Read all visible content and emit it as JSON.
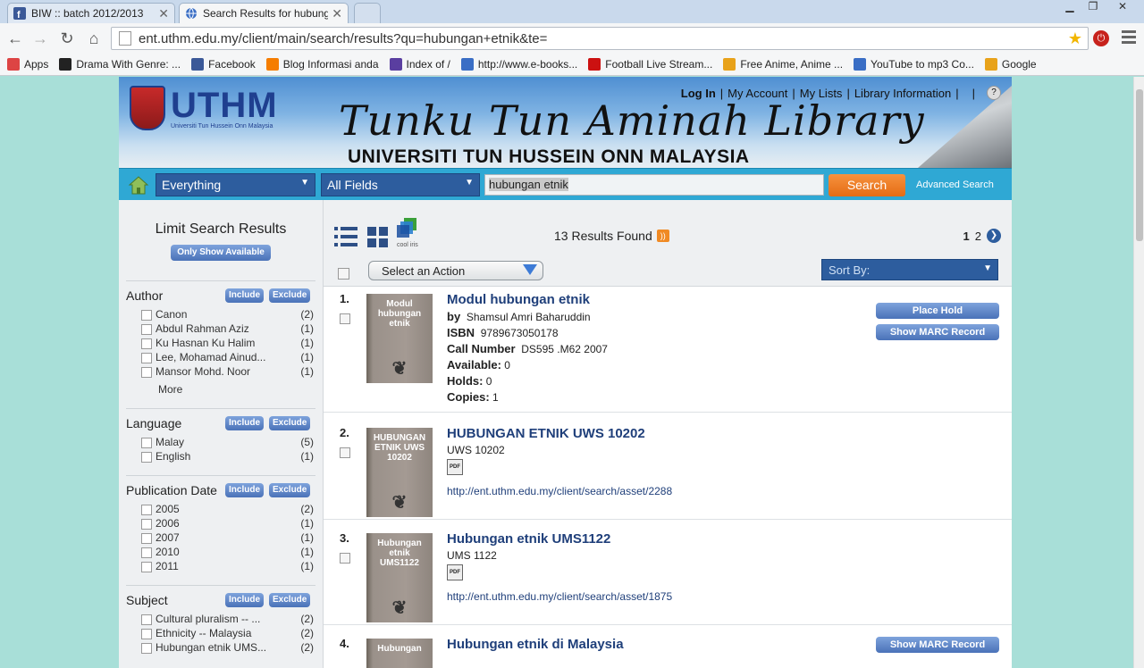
{
  "browser": {
    "tabs": [
      {
        "title": "BIW :: batch 2012/2013",
        "favicon": "facebook-icon"
      },
      {
        "title": "Search Results for hubung",
        "favicon": "globe-icon"
      }
    ],
    "url": "ent.uthm.edu.my/client/main/search/results?qu=hubungan+etnik&te=",
    "bookmarks": [
      {
        "label": "Apps",
        "icon": "apps-grid-icon",
        "color": "#d44"
      },
      {
        "label": "Drama With Genre: ...",
        "icon": "drama-icon",
        "color": "#222"
      },
      {
        "label": "Facebook",
        "icon": "facebook-icon",
        "color": "#3b5998"
      },
      {
        "label": "Blog Informasi anda",
        "icon": "blogger-icon",
        "color": "#f57d00"
      },
      {
        "label": "Index of /",
        "icon": "shield-icon",
        "color": "#5a3ea0"
      },
      {
        "label": "http://www.e-books...",
        "icon": "circle-icon",
        "color": "#3a6ec5"
      },
      {
        "label": "Football Live Stream...",
        "icon": "tv-icon",
        "color": "#c11"
      },
      {
        "label": "Free Anime, Anime ...",
        "icon": "anime-icon",
        "color": "#e8a21a"
      },
      {
        "label": "YouTube to mp3 Co...",
        "icon": "mp3-icon",
        "color": "#3a6ec5"
      },
      {
        "label": "Google",
        "icon": "google-icon",
        "color": "#e8a21a"
      }
    ]
  },
  "site": {
    "logo_text": "UTHM",
    "logo_subtext": "Universiti Tun Hussein Onn Malaysia",
    "library_title": "Tunku Tun Aminah Library",
    "library_subtitle": "UNIVERSITI TUN HUSSEIN ONN MALAYSIA",
    "top_links": [
      "Log In",
      "My Account",
      "My Lists",
      "Library Information"
    ]
  },
  "search": {
    "scope": "Everything",
    "field": "All Fields",
    "query": "hubungan etnik",
    "button": "Search",
    "advanced": "Advanced Search"
  },
  "sidebar": {
    "title": "Limit Search Results",
    "only_available": "Only Show Available",
    "include": "Include",
    "exclude": "Exclude",
    "more": "More",
    "facets": [
      {
        "name": "Author",
        "items": [
          {
            "label": "Canon",
            "count": "(2)"
          },
          {
            "label": "Abdul Rahman Aziz",
            "count": "(1)"
          },
          {
            "label": "Ku Hasnan Ku Halim",
            "count": "(1)"
          },
          {
            "label": "Lee, Mohamad Ainud...",
            "count": "(1)"
          },
          {
            "label": "Mansor Mohd. Noor",
            "count": "(1)"
          }
        ]
      },
      {
        "name": "Language",
        "items": [
          {
            "label": "Malay",
            "count": "(5)"
          },
          {
            "label": "English",
            "count": "(1)"
          }
        ]
      },
      {
        "name": "Publication Date",
        "items": [
          {
            "label": "2005",
            "count": "(2)"
          },
          {
            "label": "2006",
            "count": "(1)"
          },
          {
            "label": "2007",
            "count": "(1)"
          },
          {
            "label": "2010",
            "count": "(1)"
          },
          {
            "label": "2011",
            "count": "(1)"
          }
        ]
      },
      {
        "name": "Subject",
        "items": [
          {
            "label": "Cultural pluralism -- ...",
            "count": "(2)"
          },
          {
            "label": "Ethnicity -- Malaysia",
            "count": "(2)"
          },
          {
            "label": "Hubungan etnik UMS...",
            "count": "(2)"
          }
        ]
      }
    ]
  },
  "results": {
    "count_text": "13 Results Found",
    "pages": [
      "1",
      "2"
    ],
    "select_action": "Select an Action",
    "sort_by": "Sort By:",
    "cooliris_label": "cool iris",
    "place_hold": "Place Hold",
    "show_marc": "Show MARC Record",
    "items": [
      {
        "num": "1.",
        "cover": "Modul hubungan etnik",
        "title": "Modul hubungan etnik",
        "by_label": "by",
        "author": "Shamsul Amri Baharuddin",
        "isbn_label": "ISBN",
        "isbn": "9789673050178",
        "call_label": "Call Number",
        "call": "DS595 .M62 2007",
        "available_label": "Available:",
        "available": "0",
        "holds_label": "Holds:",
        "holds": "0",
        "copies_label": "Copies:",
        "copies": "1"
      },
      {
        "num": "2.",
        "cover": "HUBUNGAN ETNIK UWS 10202",
        "title": "HUBUNGAN ETNIK UWS 10202",
        "subtitle": "UWS 10202",
        "link": "http://ent.uthm.edu.my/client/search/asset/2288"
      },
      {
        "num": "3.",
        "cover": "Hubungan etnik UMS1122",
        "title": "Hubungan etnik UMS1122",
        "subtitle": "UMS 1122",
        "link": "http://ent.uthm.edu.my/client/search/asset/1875"
      },
      {
        "num": "4.",
        "cover": "Hubungan",
        "title": "Hubungan etnik di Malaysia"
      }
    ]
  },
  "colors": {
    "accent_blue": "#2d5d9e",
    "search_orange": "#e46c14",
    "searchbar_cyan": "#2fa8d4",
    "page_bg": "#a8dfd8"
  }
}
